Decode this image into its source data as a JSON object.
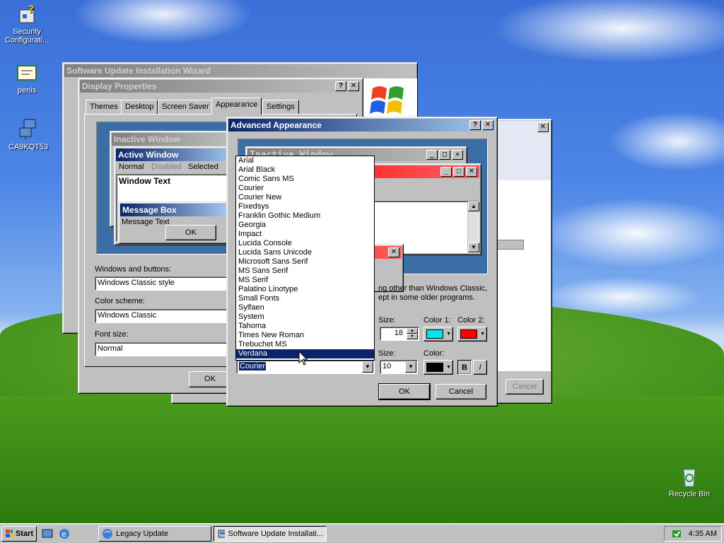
{
  "desktop": {
    "icons": [
      {
        "label": "Security Configurati..."
      },
      {
        "label": "penis"
      },
      {
        "label": "CA9KQT53"
      },
      {
        "label": "Recycle Bin"
      }
    ]
  },
  "wizard": {
    "title": "Software Update Installation Wizard",
    "cancel_label": "Cancel"
  },
  "display_properties": {
    "title": "Display Properties",
    "tabs": [
      "Themes",
      "Desktop",
      "Screen Saver",
      "Appearance",
      "Settings"
    ],
    "preview": {
      "inactive_title": "Inactive Window",
      "active_title": "Active Window",
      "menu_normal": "Normal",
      "menu_disabled": "Disabled",
      "menu_selected": "Selected",
      "window_text": "Window Text",
      "msgbox_title": "Message Box",
      "msgbox_text": "Message Text",
      "msgbox_ok": "OK"
    },
    "windows_buttons_label": "Windows and buttons:",
    "windows_buttons_value": "Windows Classic style",
    "color_scheme_label": "Color scheme:",
    "color_scheme_value": "Windows Classic",
    "font_size_label": "Font size:",
    "font_size_value": "Normal",
    "ok_label": "OK"
  },
  "advanced": {
    "title": "Advanced Appearance",
    "preview_inactive": "Inactive Window",
    "info_line1": "ng other than Windows Classic,",
    "info_line2": "ept in some older programs.",
    "size_label": "Size:",
    "size_value": "18",
    "color1_label": "Color 1:",
    "color2_label": "Color 2:",
    "color1": "#00e5e5",
    "color2": "#ff0000",
    "font_size_label": "Size:",
    "font_size_value": "10",
    "font_color_label": "Color:",
    "font_color": "#000000",
    "bold_label": "B",
    "italic_label": "I",
    "font_value": "Courier",
    "ok_label": "OK",
    "cancel_label": "Cancel"
  },
  "font_list": [
    "Arial",
    "Arial Black",
    "Comic Sans MS",
    "Courier",
    "Courier New",
    "Fixedsys",
    "Franklin Gothic Medium",
    "Georgia",
    "Impact",
    "Lucida Console",
    "Lucida Sans Unicode",
    "Microsoft Sans Serif",
    "MS Sans Serif",
    "MS Serif",
    "Palatino Linotype",
    "Small Fonts",
    "Sylfaen",
    "System",
    "Tahoma",
    "Times New Roman",
    "Trebuchet MS",
    "Verdana"
  ],
  "font_list_highlighted": "Verdana",
  "taskbar": {
    "start_label": "Start",
    "tasks": [
      "Legacy Update",
      "Software Update Installati..."
    ],
    "clock": "4:35 AM"
  }
}
